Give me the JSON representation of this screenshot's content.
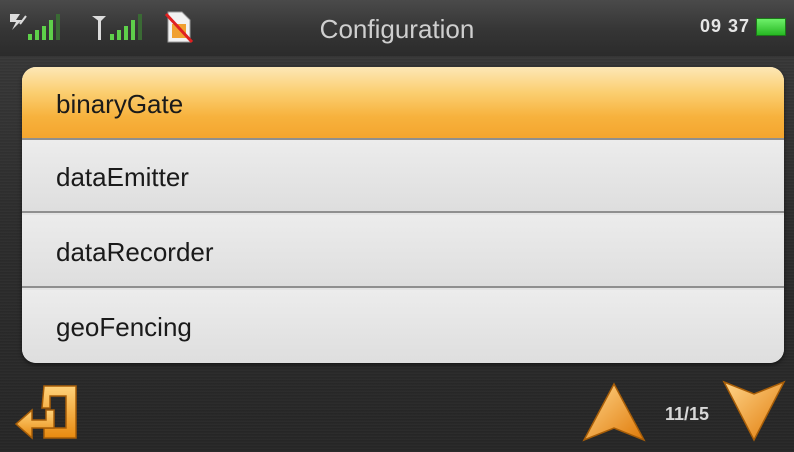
{
  "status_bar": {
    "title": "Configuration",
    "time": "09 37",
    "icons": [
      "satellite-signal-icon",
      "gsm-signal-icon",
      "sd-card-missing-icon",
      "battery-icon"
    ],
    "battery_color": "#2ecc28"
  },
  "list": {
    "items": [
      {
        "label": "binaryGate",
        "selected": true
      },
      {
        "label": "dataEmitter",
        "selected": false
      },
      {
        "label": "dataRecorder",
        "selected": false
      },
      {
        "label": "geoFencing",
        "selected": false
      }
    ],
    "selected_color": "#f7b23d"
  },
  "footer": {
    "page": "11/15",
    "back_icon": "back-arrow-icon",
    "up_icon": "arrow-up-icon",
    "down_icon": "arrow-down-icon",
    "accent_color": "#f5a020"
  }
}
